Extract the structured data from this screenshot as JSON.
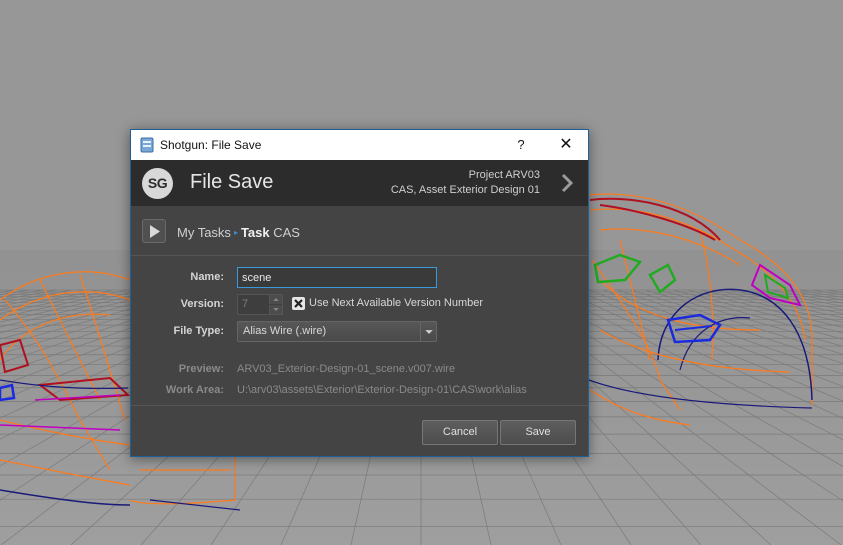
{
  "window": {
    "title": "Shotgun: File Save",
    "help_label": "?",
    "close_label": "✕",
    "app_icon": "shotgun-app-icon"
  },
  "header": {
    "logo_text": "SG",
    "title": "File Save",
    "context_project": "Project ARV03",
    "context_entity": "CAS, Asset Exterior Design 01",
    "expand_icon": "chevron-right-icon"
  },
  "breadcrumb": {
    "root": "My Tasks",
    "separator": "▸",
    "task_prefix": "Task",
    "task_name": "CAS"
  },
  "form": {
    "name_label": "Name:",
    "name_value": "scene",
    "version_label": "Version:",
    "version_value": "7",
    "use_next_version_checked": true,
    "use_next_version_label": "Use Next Available Version Number",
    "file_type_label": "File Type:",
    "file_type_value": "Alias Wire (.wire)",
    "preview_label": "Preview:",
    "preview_value": "ARV03_Exterior-Design-01_scene.v007.wire",
    "work_area_label": "Work Area:",
    "work_area_value": "U:\\arv03\\assets\\Exterior\\Exterior-Design-01\\CAS\\work\\alias"
  },
  "buttons": {
    "cancel": "Cancel",
    "save": "Save"
  },
  "colors": {
    "viewport_bg": "#9a9a9a",
    "dialog_bg": "#444444",
    "header_bg": "#2c2c2c",
    "accent": "#3a9ad9",
    "wire_orange": "#ff7a1a",
    "wire_navy": "#1a1a7a",
    "wire_red": "#b01020",
    "wire_green": "#22aa22",
    "wire_blue": "#1a2ae0",
    "wire_magenta": "#c000c0"
  }
}
